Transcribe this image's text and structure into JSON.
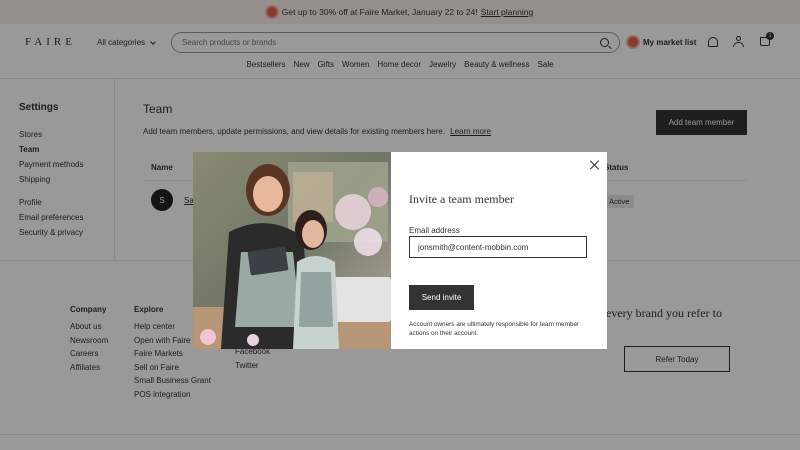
{
  "promo": {
    "text": "Get up to 30% off at Faire Market, January 22 to 24!",
    "link": "Start planning"
  },
  "header": {
    "logo": "FAIRE",
    "all_categories": "All categories",
    "search_placeholder": "Search products or brands",
    "market_list": "My market list",
    "cart_count": "1"
  },
  "categories": [
    "Bestsellers",
    "New",
    "Gifts",
    "Women",
    "Home decor",
    "Jewelry",
    "Beauty & wellness",
    "Sale"
  ],
  "settings": {
    "title": "Settings",
    "group1": [
      "Stores",
      "Team",
      "Payment methods",
      "Shipping"
    ],
    "group2": [
      "Profile",
      "Email preferences",
      "Security & privacy"
    ],
    "active": "Team"
  },
  "team": {
    "title": "Team",
    "description": "Add team members, update permissions, and view details for existing members here.",
    "learn_more": "Learn more",
    "add_button": "Add team member",
    "col_name": "Name",
    "col_status": "Status",
    "row": {
      "initial": "S",
      "name": "Sa",
      "status": "Active"
    }
  },
  "footer": {
    "company": {
      "heading": "Company",
      "links": [
        "About us",
        "Newsroom",
        "Careers",
        "Affiliates"
      ]
    },
    "explore": {
      "heading": "Explore",
      "links": [
        "Help center",
        "Open with Faire",
        "Faire Markets",
        "Sell on Faire",
        "Small Business Grant",
        "POS integration"
      ]
    },
    "social": [
      "Facebook",
      "Twitter"
    ],
    "refer_text": "every brand you refer to",
    "refer_button": "Refer Today"
  },
  "modal": {
    "title": "Invite a team member",
    "email_label": "Email address",
    "email_value": "jonsmith@content-mobbin.com",
    "send_button": "Send invite",
    "note": "Account owners are ultimately responsible for team member actions on their account."
  },
  "colors": {
    "dark": "#333333",
    "accent": "#e2634a",
    "promo_bg": "#fbf1ec"
  }
}
